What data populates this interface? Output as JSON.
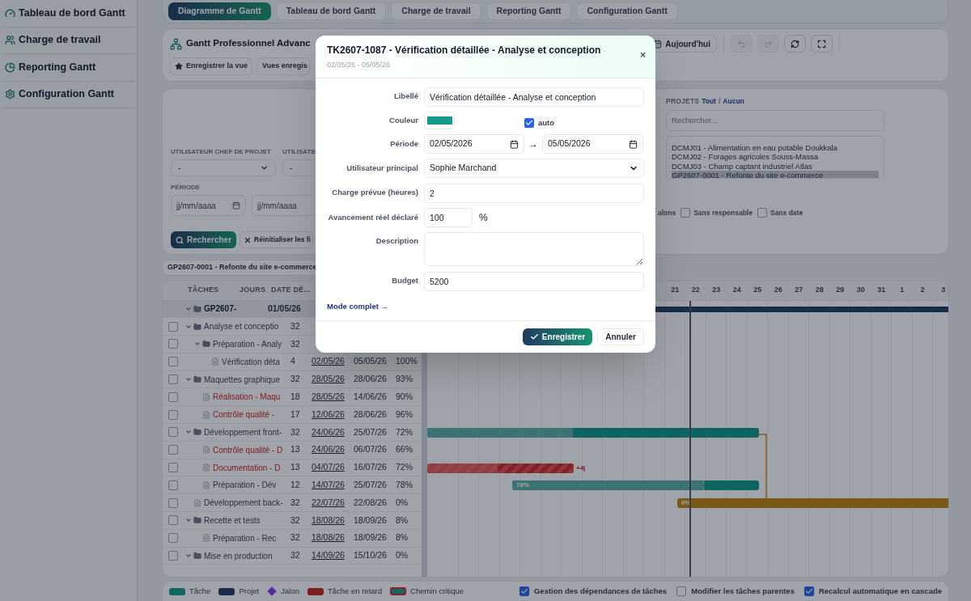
{
  "sidebar": {
    "items": [
      {
        "label": "Tableau de bord Gantt"
      },
      {
        "label": "Charge de travail"
      },
      {
        "label": "Reporting Gantt"
      },
      {
        "label": "Configuration Gantt"
      }
    ]
  },
  "tabs": [
    {
      "label": "Diagramme de Gantt",
      "selected": true
    },
    {
      "label": "Tableau de bord Gantt",
      "selected": false
    },
    {
      "label": "Charge de travail",
      "selected": false
    },
    {
      "label": "Reporting Gantt",
      "selected": false
    },
    {
      "label": "Configuration Gantt",
      "selected": false
    }
  ],
  "toolbar": {
    "title": "Gantt Professionnel Advanc",
    "save_view": "Enregistrer la vue",
    "saved_views": "Vues enregis",
    "today": "Aujourd'hui",
    "actions": [
      {
        "kind": "undo",
        "disabled": true
      },
      {
        "kind": "redo",
        "disabled": true
      },
      {
        "kind": "refresh",
        "disabled": false
      },
      {
        "kind": "fullscreen",
        "disabled": false
      }
    ]
  },
  "filters": {
    "fields": [
      {
        "label": "UTILISATEUR CHEF DE PROJET",
        "value": "-"
      },
      {
        "label": "UTILISATE",
        "value": "-"
      }
    ],
    "period": {
      "label": "PÉRIODE",
      "from_placeholder": "jj/mm/aaaa",
      "to_placeholder": "jj/mm/aaaa"
    },
    "search_button": "Rechercher",
    "reset_button": "Réinitialiser les fi",
    "projects": {
      "label": "PROJETS",
      "all": "Tout",
      "separator": "/",
      "none": "Aucun",
      "search_placeholder": "Rechercher...",
      "items": [
        {
          "label": "DCMJ01 - Alimentation en eau potable Doukkala",
          "selected": false
        },
        {
          "label": "DCMJ02 - Forages agricoles Souss-Massa",
          "selected": false
        },
        {
          "label": "DCMJ03 - Champ captant industriel Atlas",
          "selected": false
        },
        {
          "label": "GP2607-0001 - Refonte du site e-commerce",
          "selected": true
        }
      ]
    },
    "partial_label": "alons",
    "checkboxes": [
      {
        "label": "Sans responsable",
        "checked": false
      },
      {
        "label": "Sans date",
        "checked": false
      }
    ]
  },
  "breadcrumb": "GP2607-0001 - Refonte du site e-commerce",
  "gantt": {
    "columns": [
      "TÂCHES",
      "JOURS",
      "DATE DÉ..."
    ],
    "days": [
      "21",
      "22",
      "23",
      "24",
      "25",
      "26",
      "27",
      "28",
      "29",
      "30",
      "31",
      "1",
      "2",
      "3"
    ],
    "rows": [
      {
        "kind": "project",
        "name": "GP2607-",
        "start": "01/05/26",
        "expanded": true,
        "bar": {
          "kind": "project"
        },
        "children": [
          {
            "kind": "group",
            "name": "Analyse et conceptio",
            "days": "32",
            "checked": false,
            "late": false,
            "expanded": true,
            "children": [
              {
                "kind": "group",
                "name": "Préparation - Analy",
                "days": "32",
                "checked": false,
                "late": false,
                "expanded": true,
                "children": [
                  {
                    "kind": "task",
                    "name": "Vérification déta",
                    "days": "4",
                    "start": "02/05/26",
                    "end": "05/05/26",
                    "progress": "100%",
                    "checked": false,
                    "late": false
                  }
                ]
              }
            ]
          },
          {
            "kind": "group",
            "name": "Maquettes graphique",
            "days": "32",
            "start": "28/05/26",
            "end": "28/06/26",
            "progress": "93%",
            "checked": false,
            "late": false,
            "expanded": true,
            "children": [
              {
                "kind": "task",
                "name": "Réalisation - Maqu",
                "days": "18",
                "start": "28/05/26",
                "end": "14/06/26",
                "progress": "90%",
                "checked": false,
                "late": true
              },
              {
                "kind": "task",
                "name": "Contrôle qualité -",
                "days": "17",
                "start": "12/06/26",
                "end": "28/06/26",
                "progress": "96%",
                "checked": false,
                "late": true
              }
            ]
          },
          {
            "kind": "group",
            "name": "Développement front-",
            "days": "32",
            "start": "24/06/26",
            "end": "25/07/26",
            "progress": "72%",
            "checked": false,
            "late": false,
            "expanded": true,
            "bar": {
              "kind": "task",
              "level": 0.44
            },
            "children": [
              {
                "kind": "task",
                "name": "Contrôle qualité - D",
                "days": "13",
                "start": "24/06/26",
                "end": "06/07/26",
                "progress": "66%",
                "checked": false,
                "late": true
              },
              {
                "kind": "task",
                "name": "Documentation - D",
                "days": "13",
                "start": "04/07/26",
                "end": "16/07/26",
                "progress": "72%",
                "checked": false,
                "late": true,
                "bar": {
                  "kind": "late",
                  "level": 0.48,
                  "label": "+4j"
                }
              },
              {
                "kind": "task",
                "name": "Préparation - Dév",
                "days": "12",
                "start": "14/07/26",
                "end": "25/07/26",
                "progress": "78%",
                "checked": false,
                "late": false,
                "bar": {
                  "kind": "task",
                  "level": 0.78,
                  "label": "78%"
                }
              }
            ]
          },
          {
            "kind": "task",
            "name": "Développement back-",
            "days": "32",
            "start": "22/07/26",
            "end": "22/08/26",
            "progress": "0%",
            "checked": false,
            "late": false,
            "bar": {
              "kind": "warning",
              "level": 0,
              "label": "0%"
            }
          },
          {
            "kind": "group",
            "name": "Recette et tests",
            "days": "32",
            "start": "18/08/26",
            "end": "18/09/26",
            "progress": "8%",
            "checked": false,
            "late": false,
            "expanded": true,
            "children": [
              {
                "kind": "task",
                "name": "Préparation - Rec",
                "days": "32",
                "start": "18/08/26",
                "end": "18/09/26",
                "progress": "8%",
                "checked": false,
                "late": false
              }
            ]
          },
          {
            "kind": "group",
            "name": "Mise en production",
            "days": "32",
            "start": "14/09/26",
            "end": "15/10/26",
            "progress": "0%",
            "checked": false,
            "late": false,
            "expanded": true
          }
        ]
      }
    ],
    "legend": [
      {
        "kind": "task",
        "label": "Tâche"
      },
      {
        "kind": "project",
        "label": "Projet"
      },
      {
        "kind": "milestone",
        "label": "Jalon"
      },
      {
        "kind": "late",
        "label": "Tâche en retard"
      },
      {
        "kind": "critical",
        "label": "Chemin critique"
      }
    ],
    "options": [
      {
        "label": "Gestion des dépendances de tâches",
        "checked": true
      },
      {
        "label": "Modifier les tâches parentes",
        "checked": false
      },
      {
        "label": "Recalcul automatique en cascade",
        "checked": true
      }
    ]
  },
  "dialog": {
    "title": "TK2607-1087 - Vérification détaillée - Analyse et conception",
    "subtitle": "· 02/05/26 - 05/05/26",
    "close": "×",
    "fields": [
      {
        "kind": "text",
        "label": "Libellé",
        "value": "Vérification détaillée - Analyse et conception"
      },
      {
        "kind": "color",
        "label": "Couleur",
        "color": "#14998a",
        "auto_label": "auto",
        "auto_checked": true
      },
      {
        "kind": "range",
        "label": "Période",
        "from": "02/05/2026",
        "arrow": "→",
        "to": "05/05/2026"
      },
      {
        "kind": "select",
        "label": "Utilisateur principal",
        "value": "Sophie Marchand"
      },
      {
        "kind": "text",
        "label": "Charge prévue (heures)",
        "value": "2"
      },
      {
        "kind": "percent",
        "label": "Avancement réel déclaré",
        "value": "100",
        "unit": "%"
      },
      {
        "kind": "textarea",
        "label": "Description"
      },
      {
        "kind": "text",
        "label": "Budget",
        "value": "5200"
      }
    ],
    "link": "Mode complet →",
    "save": "Enregistrer",
    "cancel": "Annuler"
  }
}
